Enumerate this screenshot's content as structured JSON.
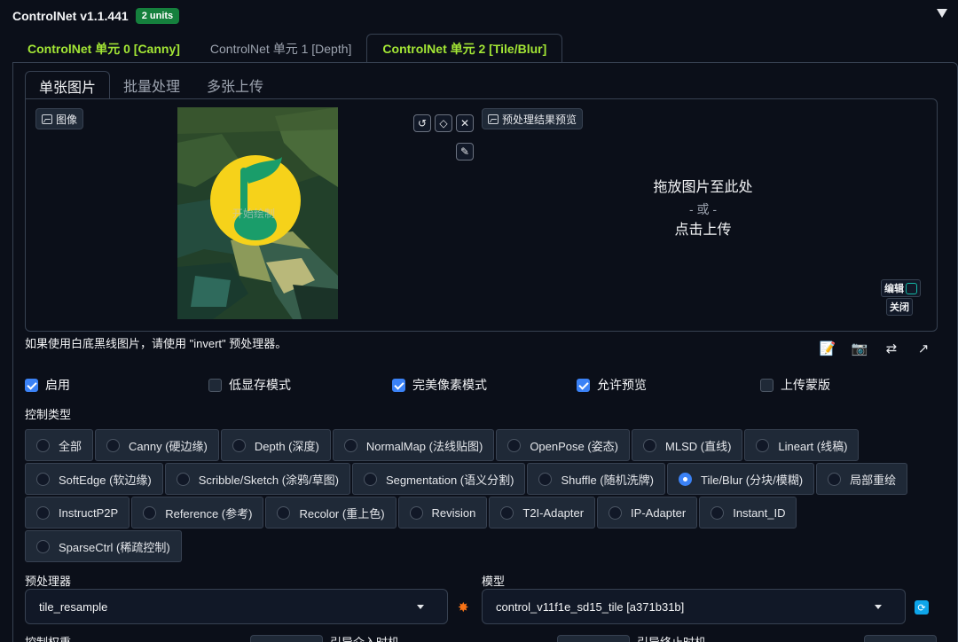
{
  "header": {
    "title": "ControlNet v1.1.441",
    "badge": "2 units"
  },
  "unit_tabs": [
    {
      "label": "ControlNet 单元 0 [Canny]"
    },
    {
      "label": "ControlNet 单元 1 [Depth]"
    },
    {
      "label": "ControlNet 单元 2 [Tile/Blur]"
    }
  ],
  "inner_tabs": [
    {
      "label": "单张图片"
    },
    {
      "label": "批量处理"
    },
    {
      "label": "多张上传"
    }
  ],
  "image_panel": {
    "image_label": "图像",
    "preview_label": "预处理结果预览",
    "watermark": "开始绘制",
    "drop_text": "拖放图片至此处",
    "drop_or": "- 或 -",
    "drop_click": "点击上传",
    "edit_btn": "编辑",
    "close_btn": "关闭"
  },
  "hint": "如果使用白底黑线图片，请使用 \"invert\" 预处理器。",
  "checkboxes": [
    {
      "label": "启用",
      "checked": true
    },
    {
      "label": "低显存模式",
      "checked": false
    },
    {
      "label": "完美像素模式",
      "checked": true
    },
    {
      "label": "允许预览",
      "checked": true
    },
    {
      "label": "上传蒙版",
      "checked": false
    }
  ],
  "control_type": {
    "label": "控制类型",
    "options": [
      {
        "label": "全部",
        "selected": false
      },
      {
        "label": "Canny (硬边缘)",
        "selected": false
      },
      {
        "label": "Depth (深度)",
        "selected": false
      },
      {
        "label": "NormalMap (法线贴图)",
        "selected": false
      },
      {
        "label": "OpenPose (姿态)",
        "selected": false
      },
      {
        "label": "MLSD (直线)",
        "selected": false
      },
      {
        "label": "Lineart (线稿)",
        "selected": false
      },
      {
        "label": "SoftEdge (软边缘)",
        "selected": false
      },
      {
        "label": "Scribble/Sketch (涂鸦/草图)",
        "selected": false
      },
      {
        "label": "Segmentation (语义分割)",
        "selected": false
      },
      {
        "label": "Shuffle (随机洗牌)",
        "selected": false
      },
      {
        "label": "Tile/Blur (分块/模糊)",
        "selected": true
      },
      {
        "label": "局部重绘",
        "selected": false
      },
      {
        "label": "InstructP2P",
        "selected": false
      },
      {
        "label": "Reference (参考)",
        "selected": false
      },
      {
        "label": "Recolor (重上色)",
        "selected": false
      },
      {
        "label": "Revision",
        "selected": false
      },
      {
        "label": "T2I-Adapter",
        "selected": false
      },
      {
        "label": "IP-Adapter",
        "selected": false
      },
      {
        "label": "Instant_ID",
        "selected": false
      },
      {
        "label": "SparseCtrl (稀疏控制)",
        "selected": false
      }
    ]
  },
  "preprocessor": {
    "label": "预处理器",
    "value": "tile_resample"
  },
  "model": {
    "label": "模型",
    "value": "control_v11f1e_sd15_tile [a371b31b]"
  },
  "bottom_row": {
    "weight": "控制权重",
    "start": "引导介入时机",
    "end": "引导终止时机"
  },
  "icons": {
    "action_icons": [
      "edit-doc-icon",
      "camera-icon",
      "swap-icon",
      "send-dims-icon"
    ],
    "accent_green": "#a3e635",
    "accent_blue": "#3b82f6"
  }
}
